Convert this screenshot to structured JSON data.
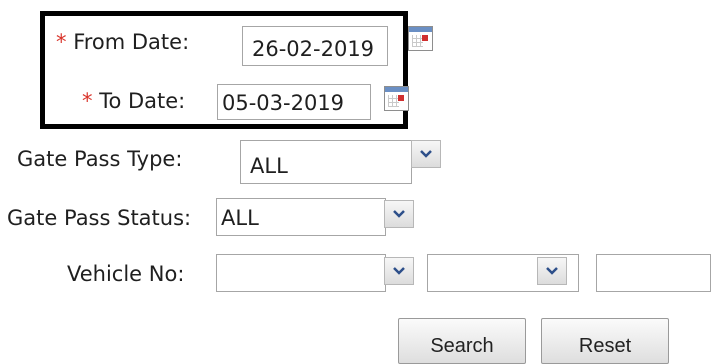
{
  "form": {
    "from_date": {
      "required_mark": "*",
      "label": "From Date:",
      "value": "26-02-2019",
      "icon": "calendar-icon"
    },
    "to_date": {
      "required_mark": "*",
      "label": "To Date:",
      "value": "05-03-2019",
      "icon": "calendar-icon"
    },
    "gate_pass_type": {
      "label": "Gate Pass Type:",
      "value": "ALL"
    },
    "gate_pass_status": {
      "label": "Gate Pass Status:",
      "value": "ALL"
    },
    "vehicle_no": {
      "label": "Vehicle No:",
      "value_1": "",
      "value_2": "",
      "value_3": ""
    }
  },
  "buttons": {
    "search_label": "Search",
    "reset_label": "Reset"
  },
  "colors": {
    "required": "#d9342b",
    "highlight_border": "#000000",
    "calendar_header": "#6a8fc4"
  }
}
